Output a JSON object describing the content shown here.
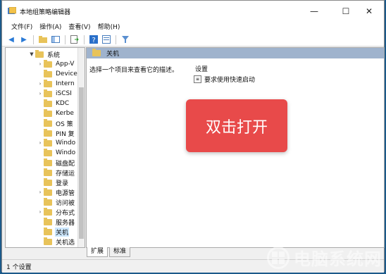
{
  "window": {
    "title": "本地组策略编辑器",
    "minimize": "—",
    "maximize": "☐",
    "close": "✕"
  },
  "menu": {
    "items": [
      "文件(F)",
      "操作(A)",
      "查看(V)",
      "帮助(H)"
    ]
  },
  "tree": {
    "items": [
      {
        "label": "系统",
        "expanded": true,
        "level": 0
      },
      {
        "label": "App-V",
        "level": 1,
        "has_children": true
      },
      {
        "label": "Device",
        "level": 1,
        "has_children": false
      },
      {
        "label": "Intern",
        "level": 1,
        "has_children": true
      },
      {
        "label": "iSCSI",
        "level": 1,
        "has_children": true
      },
      {
        "label": "KDC",
        "level": 1,
        "has_children": false
      },
      {
        "label": "Kerbe",
        "level": 1,
        "has_children": false
      },
      {
        "label": "OS 策",
        "level": 1,
        "has_children": false
      },
      {
        "label": "PIN 复",
        "level": 1,
        "has_children": false
      },
      {
        "label": "Windo",
        "level": 1,
        "has_children": true
      },
      {
        "label": "Windo",
        "level": 1,
        "has_children": false
      },
      {
        "label": "磁盘配",
        "level": 1,
        "has_children": false
      },
      {
        "label": "存储运",
        "level": 1,
        "has_children": false
      },
      {
        "label": "登录",
        "level": 1,
        "has_children": false
      },
      {
        "label": "电源管",
        "level": 1,
        "has_children": true
      },
      {
        "label": "访问被",
        "level": 1,
        "has_children": false
      },
      {
        "label": "分布式",
        "level": 1,
        "has_children": true
      },
      {
        "label": "服务器",
        "level": 1,
        "has_children": false
      },
      {
        "label": "关机",
        "level": 1,
        "has_children": false,
        "selected": true
      },
      {
        "label": "关机选",
        "level": 1,
        "has_children": false
      }
    ]
  },
  "content": {
    "header": "关机",
    "description": "选择一个项目来查看它的描述。",
    "settings_header": "设置",
    "settings": [
      "要求使用快速启动"
    ]
  },
  "callout": {
    "text": "双击打开"
  },
  "tabs": [
    "扩展",
    "标准"
  ],
  "status": {
    "text": "1 个设置"
  },
  "watermark": {
    "text": "电脑系统网"
  }
}
